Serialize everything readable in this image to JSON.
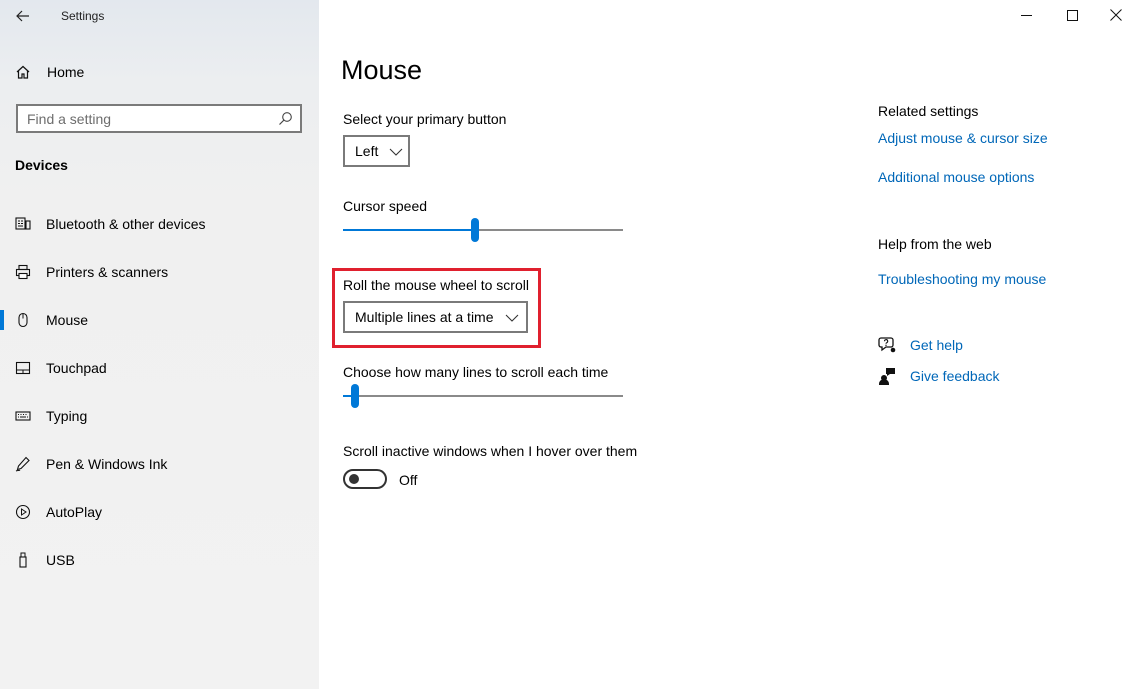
{
  "window": {
    "title": "Settings",
    "controls": [
      "minimize",
      "maximize",
      "close"
    ]
  },
  "sidebar": {
    "home_label": "Home",
    "search_placeholder": "Find a setting",
    "section_title": "Devices",
    "selected_index": 2,
    "items": [
      {
        "label": "Bluetooth & other devices",
        "icon": "bluetooth-devices-icon"
      },
      {
        "label": "Printers & scanners",
        "icon": "printer-icon"
      },
      {
        "label": "Mouse",
        "icon": "mouse-icon"
      },
      {
        "label": "Touchpad",
        "icon": "touchpad-icon"
      },
      {
        "label": "Typing",
        "icon": "keyboard-icon"
      },
      {
        "label": "Pen & Windows Ink",
        "icon": "pen-icon"
      },
      {
        "label": "AutoPlay",
        "icon": "autoplay-icon"
      },
      {
        "label": "USB",
        "icon": "usb-icon"
      }
    ]
  },
  "main": {
    "title": "Mouse",
    "primary_button": {
      "label": "Select your primary button",
      "value": "Left"
    },
    "cursor_speed": {
      "label": "Cursor speed",
      "value_fraction": 0.47
    },
    "scroll_mode": {
      "label": "Roll the mouse wheel to scroll",
      "value": "Multiple lines at a time"
    },
    "scroll_lines": {
      "label": "Choose how many lines to scroll each time",
      "value_fraction": 0.03
    },
    "inactive_scroll": {
      "label": "Scroll inactive windows when I hover over them",
      "state": "Off"
    }
  },
  "related": {
    "title": "Related settings",
    "links": [
      "Adjust mouse & cursor size",
      "Additional mouse options"
    ],
    "web_title": "Help from the web",
    "web_links": [
      "Troubleshooting my mouse"
    ],
    "get_help": "Get help",
    "give_feedback": "Give feedback"
  },
  "colors": {
    "accent": "#0078d7",
    "link": "#0067b8",
    "highlight": "#e0202e"
  }
}
